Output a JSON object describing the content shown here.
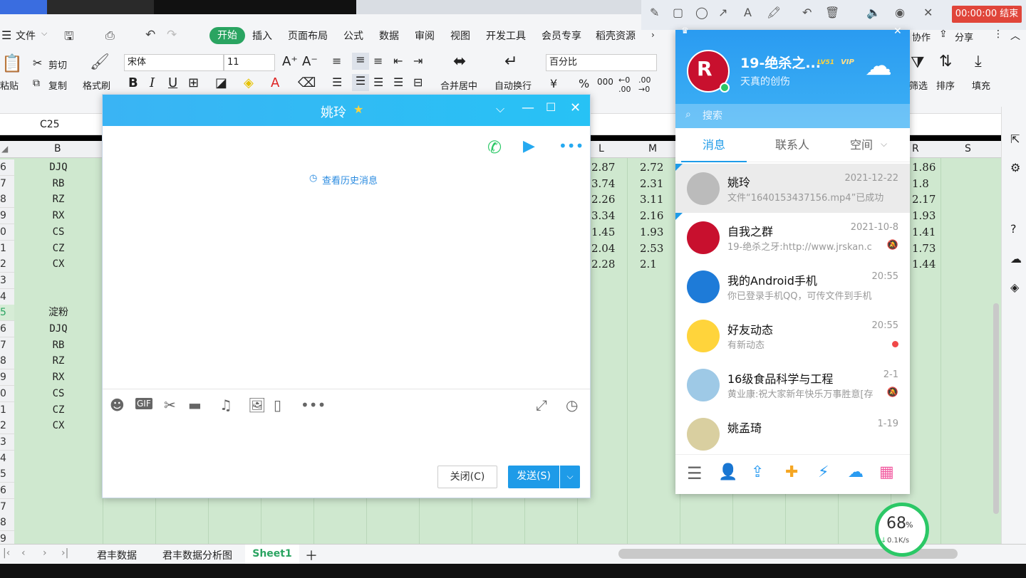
{
  "wps": {
    "menu": [
      "文件",
      "开始",
      "插入",
      "页面布局",
      "公式",
      "数据",
      "审阅",
      "视图",
      "开发工具",
      "会员专享",
      "稻壳资源"
    ],
    "collab": "协作",
    "share": "分享",
    "clipboard": {
      "paste": "粘贴",
      "cut": "剪切",
      "copy": "复制",
      "format_painter": "格式刷"
    },
    "font_name": "宋体",
    "font_size": "11",
    "merge_center": "合并居中",
    "wrap": "自动换行",
    "number_format": "百分比",
    "sort": "排序",
    "fill": "填充",
    "filter": "筛选",
    "cell_ref": "C25",
    "columns": {
      "B": "B",
      "L": "L",
      "M": "M",
      "R": "R",
      "S": "S"
    },
    "rows": [
      {
        "n": "6",
        "b": "DJQ",
        "l": "2.87",
        "m": "2.72",
        "r": "1.86"
      },
      {
        "n": "7",
        "b": "RB",
        "l": "3.74",
        "m": "2.31",
        "r": "1.8"
      },
      {
        "n": "8",
        "b": "RZ",
        "l": "2.26",
        "m": "3.11",
        "r": "2.17"
      },
      {
        "n": "9",
        "b": "RX",
        "l": "3.34",
        "m": "2.16",
        "r": "1.93"
      },
      {
        "n": "0",
        "b": "CS",
        "l": "1.45",
        "m": "1.93",
        "r": "1.41"
      },
      {
        "n": "1",
        "b": "CZ",
        "l": "2.04",
        "m": "2.53",
        "r": "1.73"
      },
      {
        "n": "2",
        "b": "CX",
        "l": "2.28",
        "m": "2.1",
        "r": "1.44"
      },
      {
        "n": "3",
        "b": ""
      },
      {
        "n": "4",
        "b": ""
      },
      {
        "n": "5",
        "b": "淀粉"
      },
      {
        "n": "6",
        "b": "DJQ"
      },
      {
        "n": "7",
        "b": "RB"
      },
      {
        "n": "8",
        "b": "RZ"
      },
      {
        "n": "9",
        "b": "RX"
      },
      {
        "n": "0",
        "b": "CS"
      },
      {
        "n": "1",
        "b": "CZ"
      },
      {
        "n": "2",
        "b": "CX"
      },
      {
        "n": "3",
        "b": ""
      },
      {
        "n": "4",
        "b": ""
      },
      {
        "n": "5",
        "b": ""
      },
      {
        "n": "6",
        "b": ""
      },
      {
        "n": "7",
        "b": ""
      },
      {
        "n": "8",
        "b": ""
      },
      {
        "n": "9",
        "b": ""
      }
    ],
    "sheets": [
      "君丰数据",
      "君丰数据分析图",
      "Sheet1"
    ],
    "rec_timer": "00:00:00 结束"
  },
  "chat": {
    "title": "姚玲",
    "history": "查看历史消息",
    "close": "关闭(C)",
    "send": "发送(S)"
  },
  "qq": {
    "nickname": "19-绝杀之...",
    "level": "LV51",
    "vip": "VIP",
    "signature": "天真的创伤",
    "search": "搜索",
    "tabs": [
      "消息",
      "联系人",
      "空间"
    ],
    "contacts": [
      {
        "name": "姚玲",
        "date": "2021-12-22",
        "msg": "文件“1640153437156.mp4”已成功"
      },
      {
        "name": "自我之群",
        "date": "2021-10-8",
        "msg": "19-绝杀之牙:http://www.jrskan.c"
      },
      {
        "name": "我的Android手机",
        "date": "20:55",
        "msg": "你已登录手机QQ，可传文件到手机"
      },
      {
        "name": "好友动态",
        "date": "20:55",
        "msg": "有新动态"
      },
      {
        "name": "16级食品科学与工程",
        "date": "2-1",
        "msg": "黄业康:祝大家新年快乐万事胜意[存"
      },
      {
        "name": "姚孟琦",
        "date": "1-19",
        "msg": ""
      }
    ]
  },
  "speed": {
    "percent": "68",
    "pct_sign": "%",
    "rate": "0.1K/s"
  },
  "colors": {
    "accent": "#2aa461",
    "qq_blue": "#2a9bf1",
    "send_blue": "#1e9be8",
    "grid_green": "#cfe8cf"
  }
}
